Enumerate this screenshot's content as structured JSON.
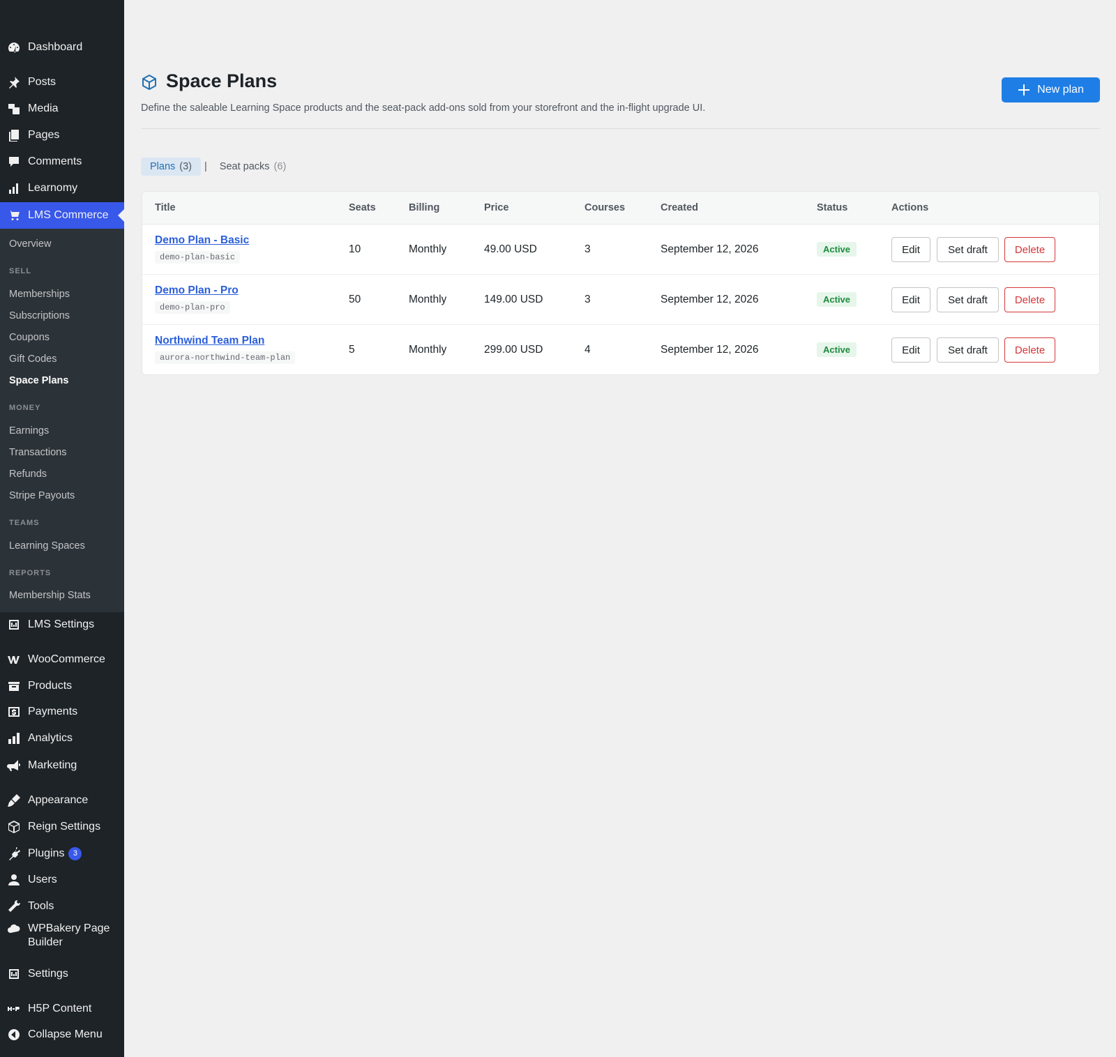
{
  "sidebar": {
    "items": [
      {
        "label": "Dashboard",
        "icon": "dashboard-icon"
      },
      {
        "label": "Posts",
        "icon": "pin-icon"
      },
      {
        "label": "Media",
        "icon": "media-icon"
      },
      {
        "label": "Pages",
        "icon": "pages-icon"
      },
      {
        "label": "Comments",
        "icon": "comments-icon"
      },
      {
        "label": "Learnomy",
        "icon": "chart-icon"
      },
      {
        "label": "LMS Commerce",
        "icon": "cart-icon"
      },
      {
        "label": "LMS Settings",
        "icon": "settings-icon"
      },
      {
        "label": "WooCommerce",
        "icon": "woocommerce-icon"
      },
      {
        "label": "Products",
        "icon": "archive-icon"
      },
      {
        "label": "Payments",
        "icon": "payments-icon"
      },
      {
        "label": "Analytics",
        "icon": "analytics-icon"
      },
      {
        "label": "Marketing",
        "icon": "megaphone-icon"
      },
      {
        "label": "Appearance",
        "icon": "brush-icon"
      },
      {
        "label": "Reign Settings",
        "icon": "cube-icon"
      },
      {
        "label": "Plugins",
        "icon": "plugin-icon",
        "badge": "3"
      },
      {
        "label": "Users",
        "icon": "user-icon"
      },
      {
        "label": "Tools",
        "icon": "wrench-icon"
      },
      {
        "label": "WPBakery Page Builder",
        "icon": "cloud-icon"
      },
      {
        "label": "Settings",
        "icon": "settings-icon"
      },
      {
        "label": "H5P Content",
        "icon": "h5p-icon"
      },
      {
        "label": "Collapse Menu",
        "icon": "collapse-icon"
      }
    ],
    "submenu": {
      "overview": "Overview",
      "sell_heading": "SELL",
      "sell": [
        "Memberships",
        "Subscriptions",
        "Coupons",
        "Gift Codes",
        "Space Plans"
      ],
      "money_heading": "MONEY",
      "money": [
        "Earnings",
        "Transactions",
        "Refunds",
        "Stripe Payouts"
      ],
      "teams_heading": "TEAMS",
      "teams": [
        "Learning Spaces"
      ],
      "reports_heading": "REPORTS",
      "reports": [
        "Membership Stats"
      ]
    }
  },
  "header": {
    "title": "Space Plans",
    "description": "Define the saleable Learning Space products and the seat-pack add-ons sold from your storefront and the in-flight upgrade UI.",
    "new_button": "New plan"
  },
  "tabs": [
    {
      "label": "Plans",
      "count": "(3)"
    },
    {
      "label": "Seat packs",
      "count": "(6)"
    }
  ],
  "tab_separator": "|",
  "table": {
    "columns": [
      "Title",
      "Seats",
      "Billing",
      "Price",
      "Courses",
      "Created",
      "Status",
      "Actions"
    ],
    "rows": [
      {
        "title": "Demo Plan - Basic",
        "slug": "demo-plan-basic",
        "seats": "10",
        "billing": "Monthly",
        "price": "49.00 USD",
        "courses": "3",
        "created": "September 12, 2026",
        "status": "Active"
      },
      {
        "title": "Demo Plan - Pro",
        "slug": "demo-plan-pro",
        "seats": "50",
        "billing": "Monthly",
        "price": "149.00 USD",
        "courses": "3",
        "created": "September 12, 2026",
        "status": "Active"
      },
      {
        "title": "Northwind Team Plan",
        "slug": "aurora-northwind-team-plan",
        "seats": "5",
        "billing": "Monthly",
        "price": "299.00 USD",
        "courses": "4",
        "created": "September 12, 2026",
        "status": "Active"
      }
    ],
    "actions": {
      "edit": "Edit",
      "draft": "Set draft",
      "delete": "Delete"
    }
  },
  "colors": {
    "sidebar_bg": "#1d2327",
    "accent": "#3858e9",
    "primary_button": "#1e7ee6",
    "link": "#2b5fd9",
    "status_active": "#1f8a3e",
    "danger": "#d63638"
  }
}
